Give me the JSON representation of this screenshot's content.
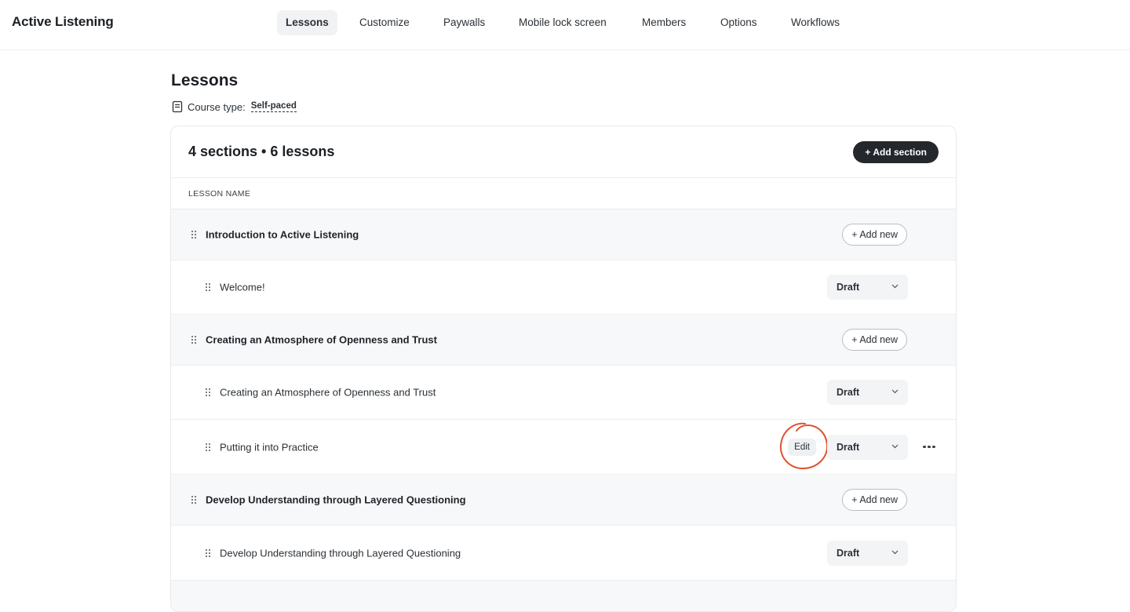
{
  "app": {
    "title": "Active Listening"
  },
  "nav": {
    "items": [
      "Lessons",
      "Customize",
      "Paywalls",
      "Mobile lock screen",
      "Members",
      "Options",
      "Workflows"
    ],
    "active": "Lessons"
  },
  "page": {
    "title": "Lessons",
    "course_type_label": "Course type:",
    "course_type_value": "Self-paced",
    "course_type_icon": "book-icon"
  },
  "card": {
    "summary": "4 sections • 6 lessons",
    "add_section_label": "+ Add section",
    "column_header": "LESSON NAME"
  },
  "rows": [
    {
      "kind": "section",
      "name": "Introduction to Active Listening",
      "action": "+ Add new"
    },
    {
      "kind": "lesson",
      "name": "Welcome!",
      "status": "Draft"
    },
    {
      "kind": "section",
      "name": "Creating an Atmosphere of Openness and Trust",
      "action": "+ Add new"
    },
    {
      "kind": "lesson",
      "name": "Creating an Atmosphere of Openness and Trust",
      "status": "Draft"
    },
    {
      "kind": "lesson",
      "name": "Putting it into Practice",
      "status": "Draft",
      "hover_edit": "Edit",
      "more_icon": "more-horizontal-icon"
    },
    {
      "kind": "section",
      "name": "Develop Understanding through Layered Questioning",
      "action": "+ Add new"
    },
    {
      "kind": "lesson",
      "name": "Develop Understanding through Layered Questioning",
      "status": "Draft"
    }
  ],
  "colors": {
    "accent_dark": "#24282d",
    "section_bg": "#f7f8fa",
    "annotation_circle": "#e0532f"
  }
}
